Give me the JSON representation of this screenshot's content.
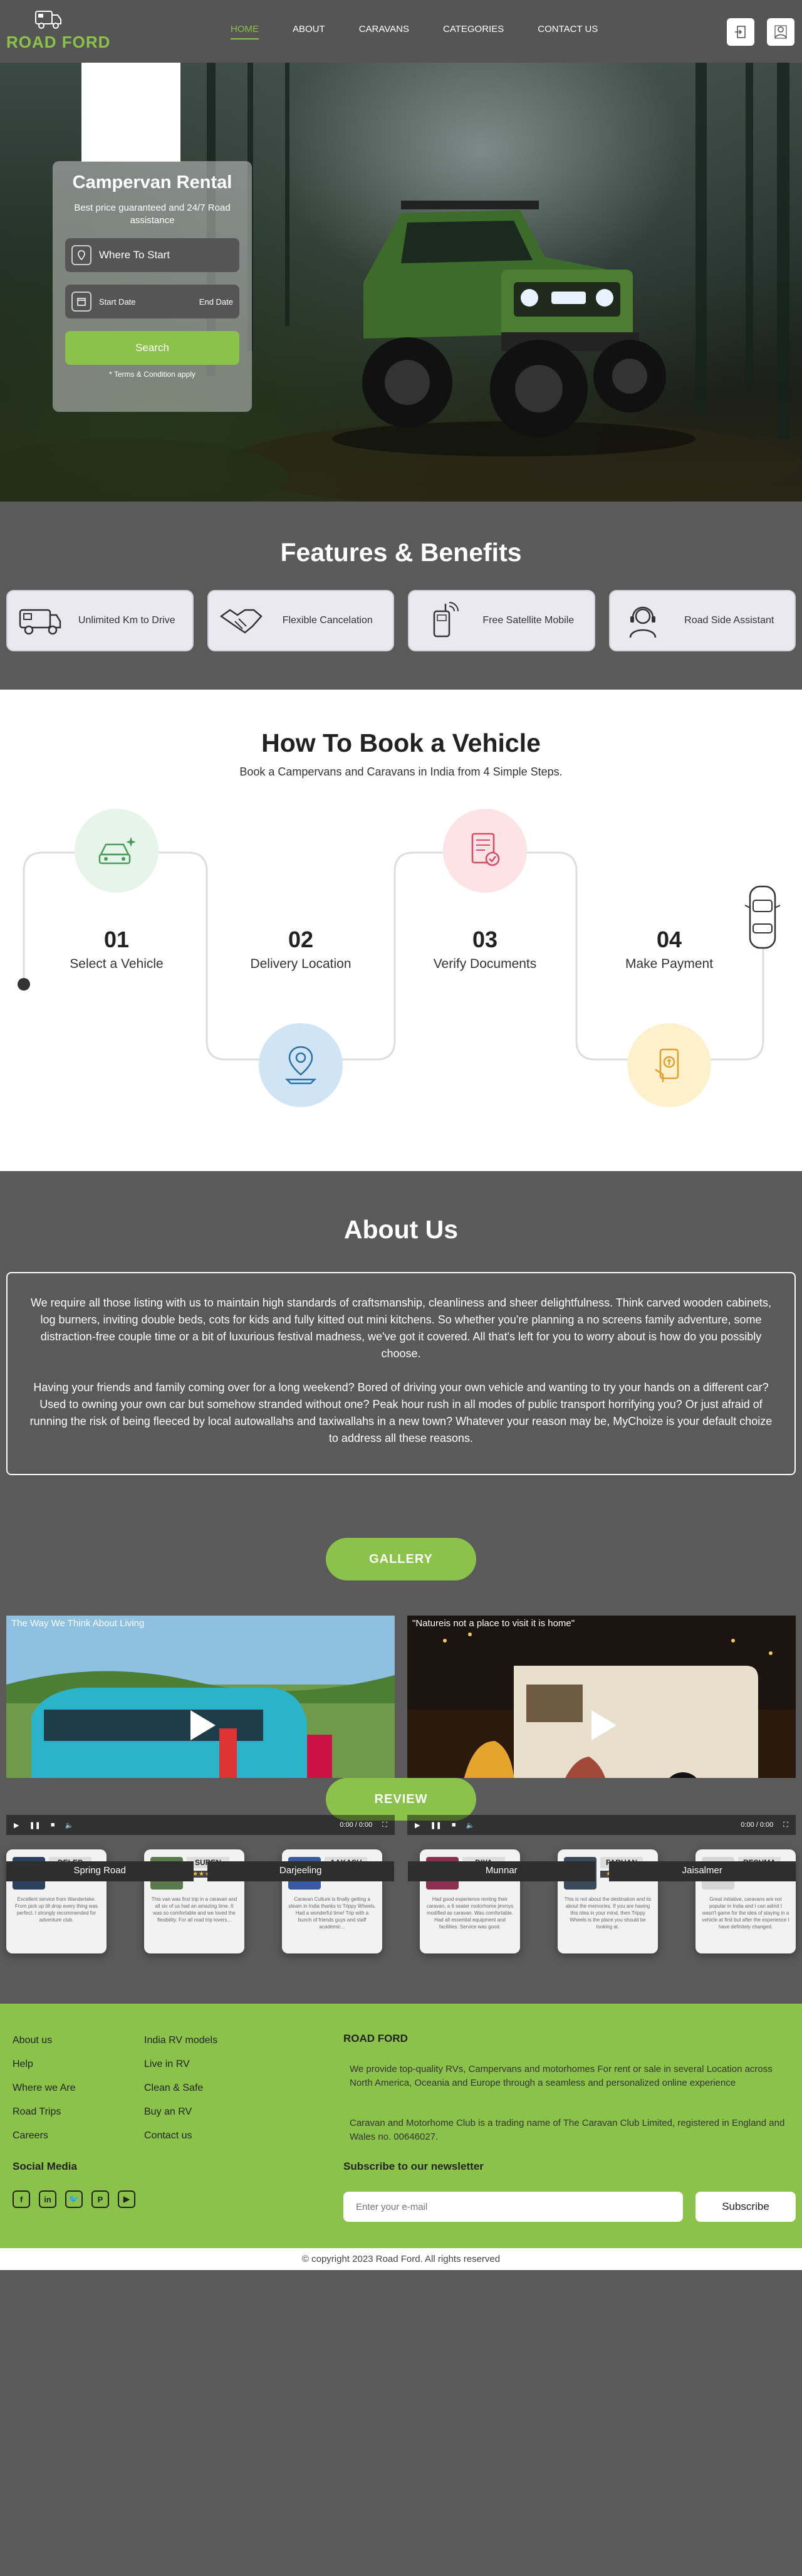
{
  "nav": {
    "brand": "ROAD FORD",
    "items": [
      "HOME",
      "ABOUT",
      "CARAVANS",
      "CATEGORIES",
      "CONTACT US"
    ],
    "active": "HOME",
    "icons": [
      "login-icon",
      "user-icon"
    ]
  },
  "hero": {
    "title": "Campervan Rental",
    "subtitle": "Best price guaranteed and 24/7 Road assistance",
    "where_placeholder": "Where To Start",
    "start_date": "Start Date",
    "end_date": "End Date",
    "search_label": "Search",
    "terms": "* Terms & Condition apply"
  },
  "features": {
    "title": "Features & Benefits",
    "items": [
      {
        "label": "Unlimited Km to Drive",
        "icon": "van-icon"
      },
      {
        "label": "Flexible Cancelation",
        "icon": "handshake-icon"
      },
      {
        "label": "Free Satellite Mobile",
        "icon": "satellite-phone-icon"
      },
      {
        "label": "Road Side Assistant",
        "icon": "headset-icon"
      }
    ]
  },
  "howto": {
    "title": "How To Book a Vehicle",
    "subtitle": "Book a Campervans and Caravans in India from 4 Simple Steps.",
    "steps": [
      {
        "num": "01",
        "label": "Select a Vehicle",
        "icon": "car-select-icon",
        "color": "#e6f5e9"
      },
      {
        "num": "02",
        "label": "Delivery Location",
        "icon": "location-pin-icon",
        "color": "#cfe5f5"
      },
      {
        "num": "03",
        "label": "Verify Documents",
        "icon": "document-check-icon",
        "color": "#fde2e6"
      },
      {
        "num": "04",
        "label": "Make Payment",
        "icon": "payment-icon",
        "color": "#fdf1cc"
      }
    ]
  },
  "about": {
    "title": "About Us",
    "p1": "We require all those listing with us to maintain high standards of craftsmanship, cleanliness and sheer delightfulness. Think carved wooden cabinets, log burners, inviting double beds, cots for kids and fully kitted out mini kitchens. So whether you're planning a no screens family adventure, some distraction-free couple time or a bit of luxurious festival madness, we've got it covered. All that's left for you to worry about is how do you possibly choose.",
    "p2": "Having your friends and family coming over for a long weekend? Bored of driving your own vehicle and wanting to try your hands on a different car? Used to owning your own car but somehow stranded without one? Peak hour rush in all modes of public transport horrifying you? Or just afraid of running the risk of being fleeced by local autowallahs and taxiwallahs in a new town? Whatever your reason may be, MyChoize is your default choize to address all these reasons.",
    "gallery_label": "GALLERY"
  },
  "videos": [
    {
      "title": "The Way We Think About Living",
      "time": "0:00 / 0:00"
    },
    {
      "title": "\"Natureis not a place to visit it is home\"",
      "time": "0:00 / 0:00"
    }
  ],
  "gallery": [
    {
      "title": "Spring Road"
    },
    {
      "title": "Darjeeling"
    },
    {
      "title": "Munnar"
    },
    {
      "title": "Jaisalmer"
    }
  ],
  "review": {
    "label": "REVIEW",
    "items": [
      {
        "name": "DELEP",
        "stars": "★★★★★",
        "text": "Excellent service from Wanderlake. From pick up till drop every thing was perfect. I strongly recommended for adventure club."
      },
      {
        "name": "SUREN",
        "stars": "★★★★★",
        "text": "This van was first trip in a caravan and all six of us had an amazing time. It was so comfortable and we loved the flexibility. For all road trip lovers..."
      },
      {
        "name": "AAKASH",
        "stars": "★★★★★",
        "text": "Caravan Culture is finally getting a steam in India thanks to Trippy Wheels. Had a wonderful time! Trip with a bunch of friends guys and staff academic..."
      },
      {
        "name": "DIYA",
        "stars": "★★★★★",
        "text": "Had good experience renting their caravan, a 6 seater motorhome jimmys modified as caravan. Was comfortable. Had all essential equipment and facilities. Service was good."
      },
      {
        "name": "FARHAN",
        "stars": "★★★★★",
        "text": "This is not about the destination and its about the memories. If you are having this idea in your mind, then Trippy Wheels is the place you should be looking at."
      },
      {
        "name": "RESHMA",
        "stars": "★★★★★",
        "text": "Great initiative, caravans are not popular in India and I can admit I wasn't game for the idea of staying in a vehicle at first but after the experience I have definitely changed."
      }
    ]
  },
  "footer": {
    "col1": [
      "About us",
      "Help",
      "Where we Are",
      "Road Trips",
      "Careers"
    ],
    "col2": [
      "India RV models",
      "Live in RV",
      "Clean & Safe",
      "Buy an RV",
      "Contact us"
    ],
    "brand": "ROAD FORD",
    "desc1": "We provide top-quality RVs, Campervans and motorhomes For rent or sale in several Location across North America, Oceania and Europe through a seamless and personalized online experience",
    "desc2": "Caravan and Motorhome Club is a trading name of The Caravan Club Limited, registered in England and Wales no. 00646027.",
    "social_title": "Social Media",
    "social": [
      "facebook-icon",
      "linkedin-icon",
      "twitter-icon",
      "pinterest-icon",
      "youtube-icon"
    ],
    "newsletter_title": "Subscribe to our newsletter",
    "email_placeholder": "Enter your e-mail",
    "subscribe_label": "Subscribe",
    "copyright": "© copyright 2023 Road Ford. All rights reserved"
  },
  "colors": {
    "accent": "#8bc34a",
    "dark": "#5a5a5a"
  }
}
